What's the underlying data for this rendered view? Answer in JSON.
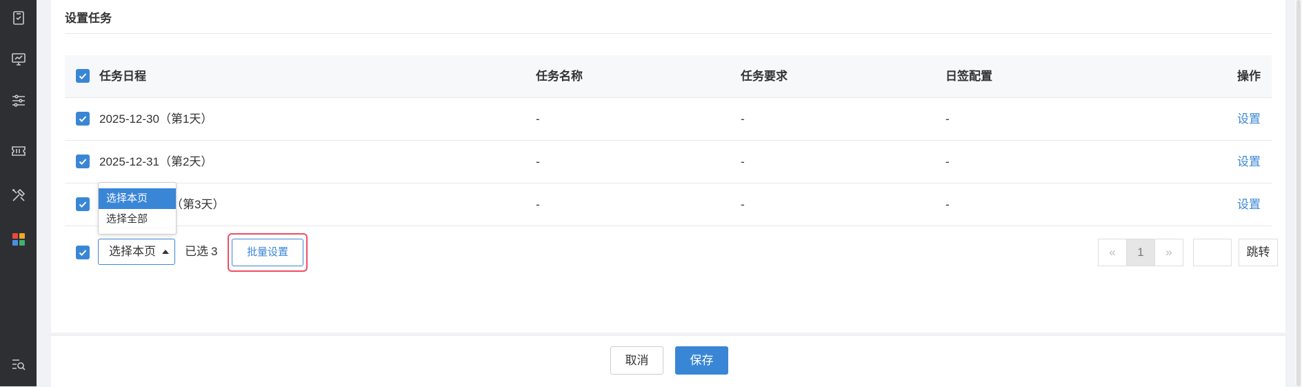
{
  "sidebar": {
    "icons": [
      "document-check-icon",
      "monitor-chart-icon",
      "sliders-icon",
      "ticket-icon",
      "tools-icon",
      "apps-grid-icon",
      "search-list-icon"
    ],
    "apps_colors": [
      "#e84a3b",
      "#f5a623",
      "#4a90e2",
      "#3cb371"
    ]
  },
  "section": {
    "title": "设置任务"
  },
  "table": {
    "headers": {
      "date": "任务日程",
      "name": "任务名称",
      "requirement": "任务要求",
      "sign": "日签配置",
      "action": "操作"
    },
    "rows": [
      {
        "date": "2025-12-30（第1天）",
        "name": "-",
        "requirement": "-",
        "sign": "-",
        "action": "设置"
      },
      {
        "date": "2025-12-31（第2天）",
        "name": "-",
        "requirement": "-",
        "sign": "-",
        "action": "设置"
      },
      {
        "date": "（第3天）",
        "name": "-",
        "requirement": "-",
        "sign": "-",
        "action": "设置"
      }
    ]
  },
  "footer": {
    "select_value": "选择本页",
    "selected_label": "已选",
    "selected_count": "3",
    "batch_label": "批量设置",
    "dropdown_options": [
      "选择本页",
      "选择全部"
    ]
  },
  "pagination": {
    "prev": "«",
    "current": "1",
    "next": "»",
    "jump_placeholder": "",
    "jump_label": "跳转"
  },
  "actions": {
    "cancel": "取消",
    "save": "保存"
  },
  "colors": {
    "accent": "#3a86d6",
    "highlight": "#ef4c62",
    "sidebar": "#2d2f33"
  }
}
